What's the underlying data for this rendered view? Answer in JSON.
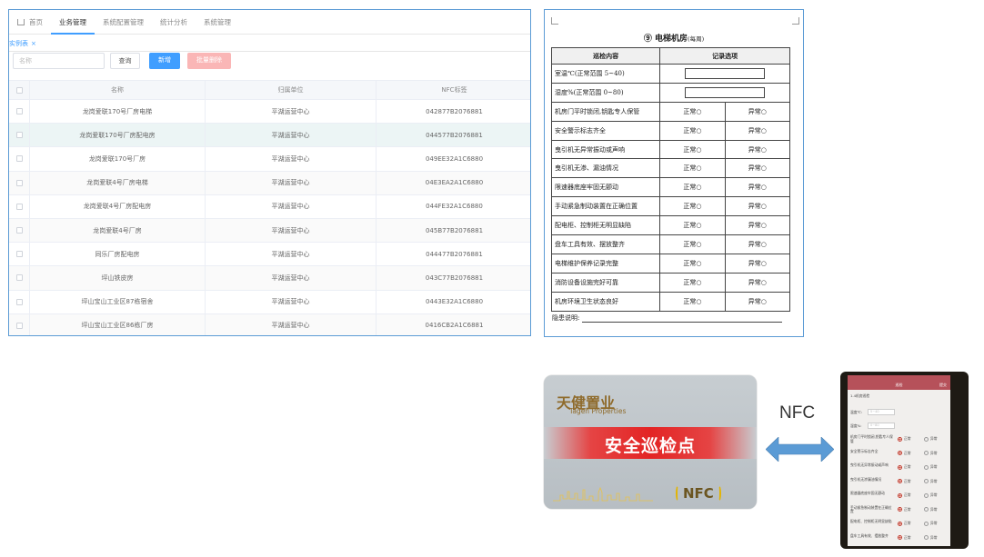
{
  "admin": {
    "nav": [
      "首页",
      "业务管理",
      "系统配置管理",
      "统计分析",
      "系统管理"
    ],
    "active_nav": "业务管理",
    "tab_label": "实例表",
    "tab_close": "×",
    "search_placeholder": "名称",
    "buttons": {
      "query": "查询",
      "add": "新增",
      "batch_delete": "批量删除"
    },
    "columns": [
      "名称",
      "归属单位",
      "NFC标签"
    ],
    "rows": [
      {
        "name": "龙岗爱联170号厂房电梯",
        "unit": "平湖运营中心",
        "nfc": "042877B2076881"
      },
      {
        "name": "龙岗爱联170号厂房配电房",
        "unit": "平湖运营中心",
        "nfc": "044577B2076881"
      },
      {
        "name": "龙岗爱联170号厂房",
        "unit": "平湖运营中心",
        "nfc": "049EE32A1C6880"
      },
      {
        "name": "龙岗爱联4号厂房电梯",
        "unit": "平湖运营中心",
        "nfc": "04E3EA2A1C6880"
      },
      {
        "name": "龙岗爱联4号厂房配电房",
        "unit": "平湖运营中心",
        "nfc": "044FE32A1C6880"
      },
      {
        "name": "龙岗爱联4号厂房",
        "unit": "平湖运营中心",
        "nfc": "045B77B2076881"
      },
      {
        "name": "同乐厂房配电房",
        "unit": "平湖运营中心",
        "nfc": "044477B2076881"
      },
      {
        "name": "坪山铁皮房",
        "unit": "平湖运营中心",
        "nfc": "043C77B2076881"
      },
      {
        "name": "坪山宝山工业区87栋宿舍",
        "unit": "平湖运营中心",
        "nfc": "0443E32A1C6880"
      },
      {
        "name": "坪山宝山工业区86栋厂房",
        "unit": "平湖运营中心",
        "nfc": "0416CB2A1C6881"
      }
    ]
  },
  "form": {
    "title": "⑨ 电梯机房",
    "title_sub": "(每周)",
    "col_content": "巡检内容",
    "col_record": "记录选项",
    "input_rows": [
      "室温℃(正常范围 5~40)",
      "湿度%(正常范围 0~80)"
    ],
    "check_rows": [
      "机房门平时锁闭,钥匙专人保管",
      "安全警示标志齐全",
      "曳引机无异常振动或声响",
      "曳引机无渗、漏油情况",
      "限速器底座牢固无颤动",
      "手动紧急制动装置在正确位置",
      "配电柜、控制柜无明显缺陷",
      "盘车工具有效、摆放整齐",
      "电梯维护保养记录完整",
      "消防设备设施完好可靠",
      "机房环境卫生状态良好"
    ],
    "normal_label": "正常○",
    "abnormal_label": "异常○",
    "note_label": "隐患说明:"
  },
  "card": {
    "brand_cn": "天健置业",
    "brand_en": "Tagen Properties",
    "title": "安全巡检点",
    "nfc_logo": "NFC"
  },
  "nfc_label": "NFC",
  "phone": {
    "header_title": "巡检",
    "header_action": "提交",
    "section": "1.4机房巡检",
    "inputs": [
      {
        "label": "温度℃:",
        "placeholder": "5~40"
      },
      {
        "label": "湿度%:",
        "placeholder": "0~80"
      }
    ],
    "items": [
      "机房门平时锁闭,钥匙专人保管",
      "安全警示标志齐全",
      "曳引机无异常振动或声响",
      "曳引机无渗漏油情况",
      "限速器底座牢固无颤动",
      "手动紧急制动装置在正确位置",
      "配电柜、控制柜无明显缺陷",
      "盘车工具有效、摆放整齐"
    ],
    "normal": "正常",
    "abnormal": "异常"
  },
  "colors": {
    "accent": "#409eff",
    "danger_light": "#fab6b6",
    "card_red": "#e32424",
    "phone_header": "#b6515a",
    "arrow": "#5b9bd5"
  }
}
